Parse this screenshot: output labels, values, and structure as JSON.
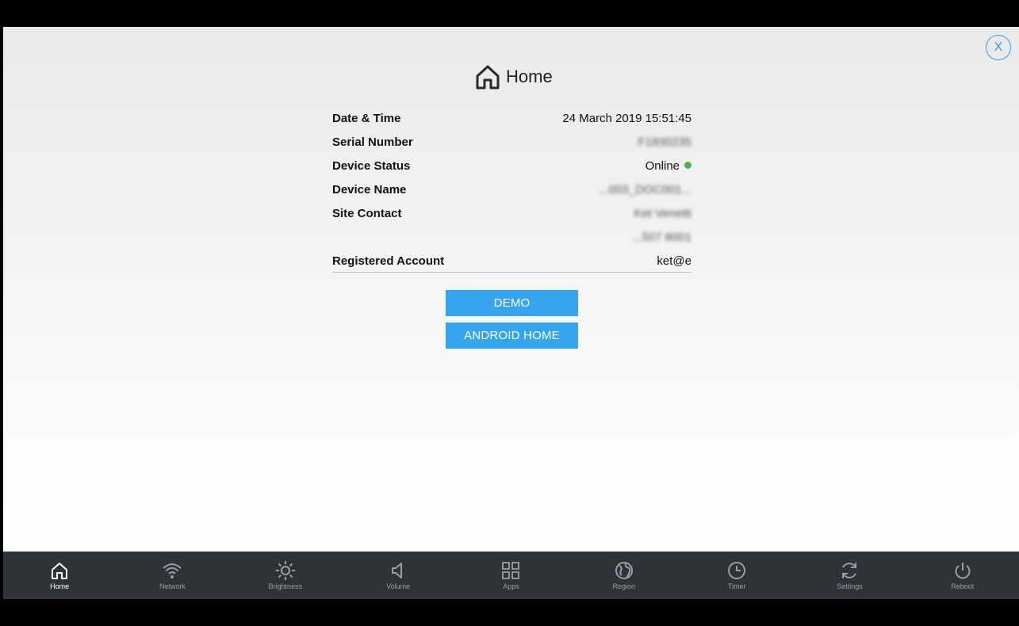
{
  "header": {
    "title": "Home",
    "close_label": "X"
  },
  "info_rows": [
    {
      "label": "Date & Time",
      "value": "24 March 2019 15:51:45"
    },
    {
      "label": "Serial Number",
      "value": "F1830235"
    },
    {
      "label": "Device Status",
      "value": "Online"
    },
    {
      "label": "Device Name",
      "value": "...003_DOC001..."
    },
    {
      "label": "Site Contact",
      "value": "Ket Venetti"
    },
    {
      "label": "",
      "value": "...507 8001"
    },
    {
      "label": "Registered Account",
      "value": "ket@e"
    }
  ],
  "buttons": {
    "demo": "DEMO",
    "android_home": "ANDROID HOME"
  },
  "dock": [
    {
      "label": "Home",
      "icon": "home-icon"
    },
    {
      "label": "Network",
      "icon": "wifi-icon"
    },
    {
      "label": "Brightness",
      "icon": "brightness-icon"
    },
    {
      "label": "Volume",
      "icon": "volume-icon"
    },
    {
      "label": "Apps",
      "icon": "apps-icon"
    },
    {
      "label": "Region",
      "icon": "globe-icon"
    },
    {
      "label": "Timer",
      "icon": "clock-icon"
    },
    {
      "label": "Settings",
      "icon": "refresh-icon"
    },
    {
      "label": "Reboot",
      "icon": "power-icon"
    }
  ],
  "colors": {
    "accent": "#36a4ee",
    "status_online": "#4caf50",
    "dock_bg": "#2f3237"
  }
}
